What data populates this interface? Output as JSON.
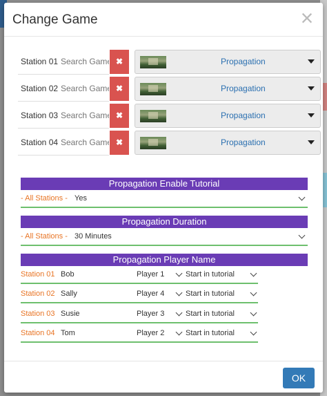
{
  "modal": {
    "title": "Change Game",
    "close_glyph": "×"
  },
  "stations": [
    {
      "label": "Station 01",
      "search_placeholder": "Search Game",
      "remove_glyph": "✖",
      "game": "Propagation"
    },
    {
      "label": "Station 02",
      "search_placeholder": "Search Game",
      "remove_glyph": "✖",
      "game": "Propagation"
    },
    {
      "label": "Station 03",
      "search_placeholder": "Search Game",
      "remove_glyph": "✖",
      "game": "Propagation"
    },
    {
      "label": "Station 04",
      "search_placeholder": "Search Game",
      "remove_glyph": "✖",
      "game": "Propagation"
    }
  ],
  "sections": {
    "tutorial": {
      "title": "Propagation Enable Tutorial",
      "label": "- All Stations -",
      "value": "Yes"
    },
    "duration": {
      "title": "Propagation Duration",
      "label": "- All Stations -",
      "value": "30 Minutes"
    },
    "players": {
      "title": "Propagation Player Name",
      "rows": [
        {
          "station": "Station 01",
          "name": "Bob",
          "slot": "Player 1",
          "mode": "Start in tutorial"
        },
        {
          "station": "Station 02",
          "name": "Sally",
          "slot": "Player 4",
          "mode": "Start in tutorial"
        },
        {
          "station": "Station 03",
          "name": "Susie",
          "slot": "Player 3",
          "mode": "Start in tutorial"
        },
        {
          "station": "Station 04",
          "name": "Tom",
          "slot": "Player 2",
          "mode": "Start in tutorial"
        }
      ]
    }
  },
  "footer": {
    "ok_label": "OK"
  },
  "colors": {
    "section_bar": "#6a3cb5",
    "remove_button": "#d9534f",
    "ok_button": "#337ab7",
    "accent_label": "#e87424",
    "underline": "#6dbf6d",
    "game_link": "#2a6fb0"
  },
  "icons": {
    "close": "close-icon",
    "remove": "remove-icon",
    "dropdown": "caret-down-icon",
    "chevron": "chevron-down-icon"
  }
}
